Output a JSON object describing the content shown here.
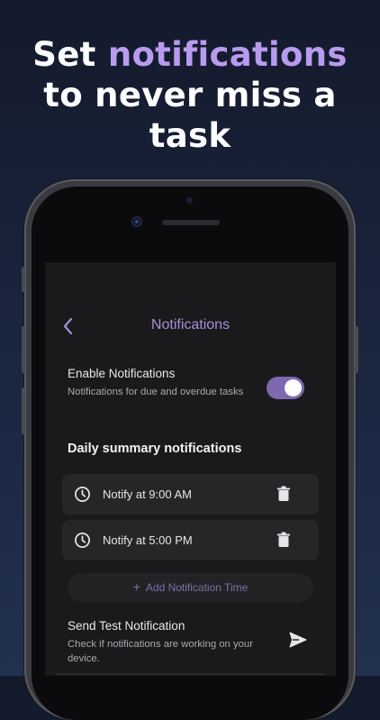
{
  "headline": {
    "part1": "Set ",
    "accent": "notifications",
    "line2": "to never miss a",
    "line3": "task",
    "accent_color": "#b89bef"
  },
  "nav": {
    "back_icon": "chevron-left-icon",
    "title": "Notifications"
  },
  "enable": {
    "title": "Enable Notifications",
    "subtitle": "Notifications for due and overdue tasks",
    "toggle_on": true,
    "toggle_color": "#7e68b0"
  },
  "daily": {
    "section_title": "Daily summary notifications",
    "items": [
      {
        "label": "Notify at 9:00 AM",
        "icon": "clock-icon",
        "action_icon": "trash-icon"
      },
      {
        "label": "Notify at 5:00 PM",
        "icon": "clock-icon",
        "action_icon": "trash-icon"
      }
    ],
    "add_label": "Add Notification Time",
    "add_icon": "plus-icon"
  },
  "test": {
    "title": "Send Test Notification",
    "subtitle": "Check if notifications are working on your device.",
    "icon": "send-icon"
  }
}
